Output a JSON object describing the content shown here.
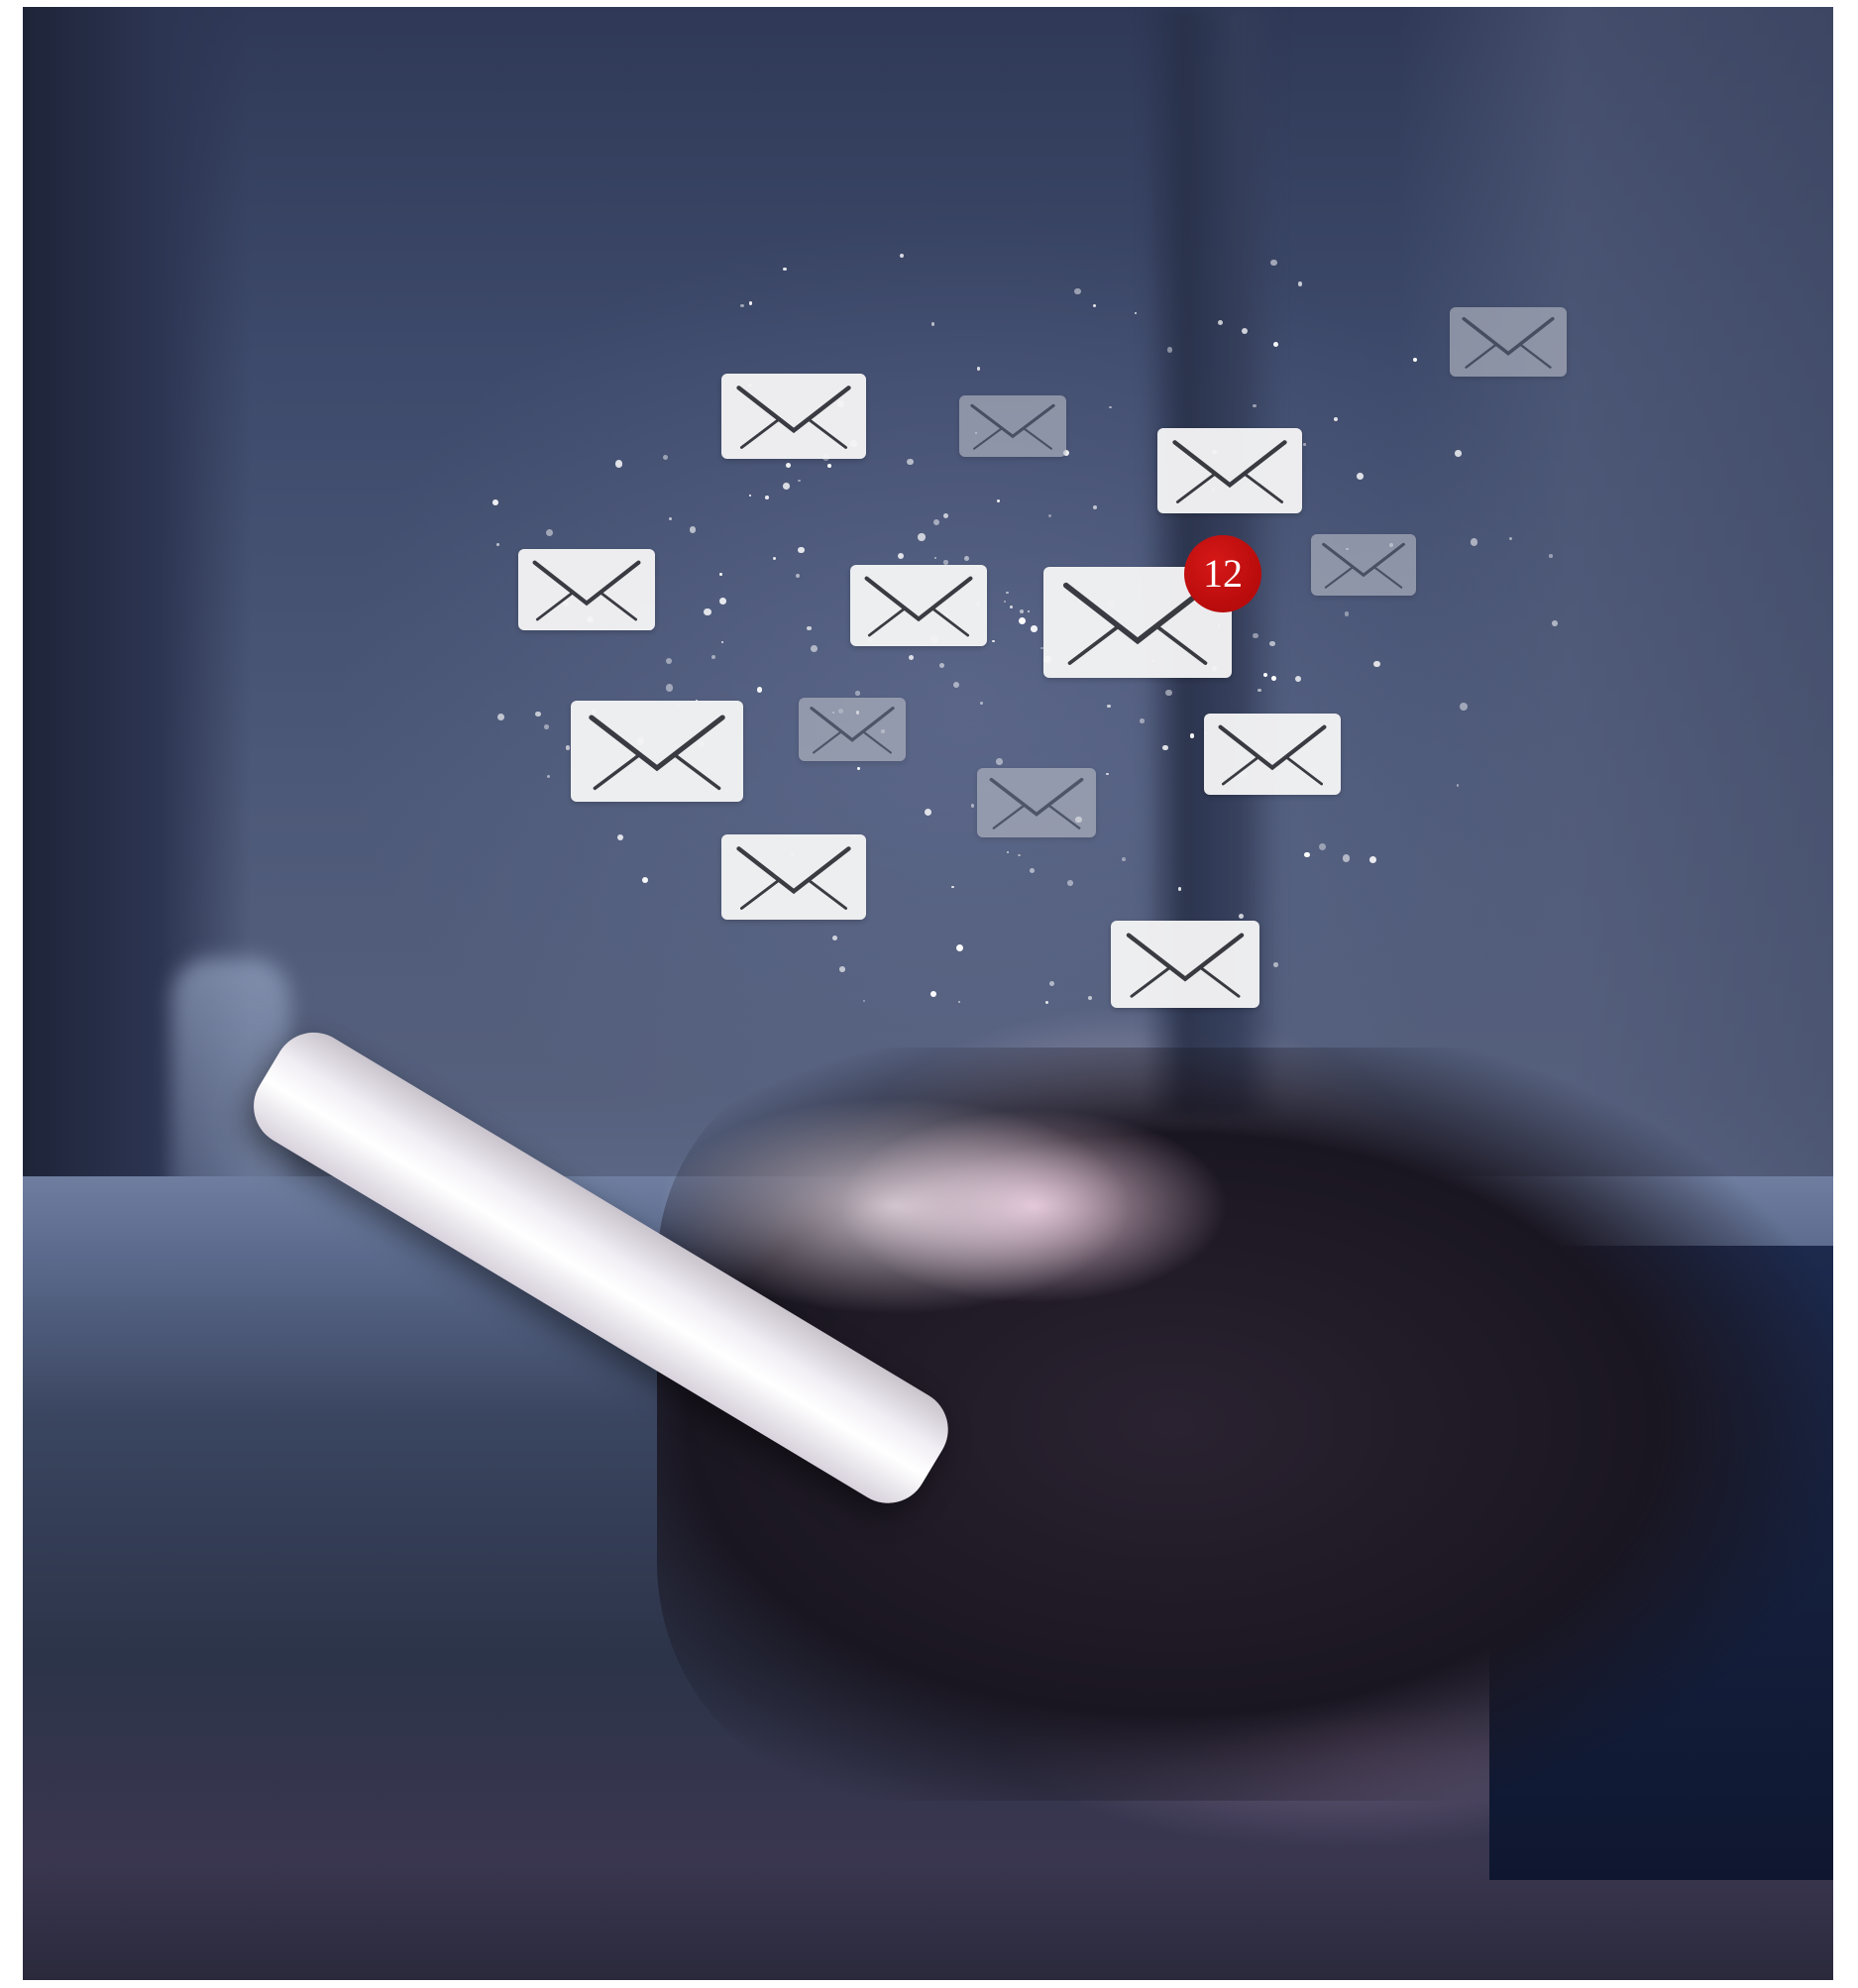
{
  "image": {
    "envelope_icon": "mail-envelope-icon",
    "notification": {
      "count": "12",
      "color": "#b80b0b"
    },
    "colors": {
      "background": "#4d5978",
      "envelope_bright": "#f4f4f5",
      "envelope_dim": "#b8bcc6"
    }
  }
}
